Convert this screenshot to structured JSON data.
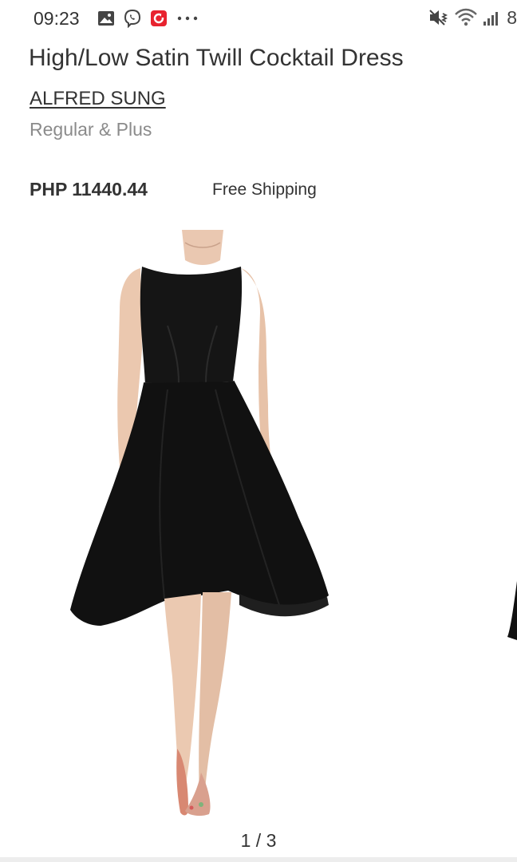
{
  "status_bar": {
    "time": "09:23",
    "battery_partial": "8",
    "left_icons": [
      "gallery-icon",
      "viber-icon",
      "app-notification-icon",
      "more-dots-icon"
    ],
    "right_icons": [
      "mute-vibrate-icon",
      "wifi-icon",
      "signal-icon"
    ]
  },
  "product": {
    "title": "High/Low Satin Twill Cocktail Dress",
    "brand": "ALFRED SUNG",
    "sizes": "Regular & Plus",
    "price": "PHP 11440.44",
    "shipping": "Free Shipping"
  },
  "gallery": {
    "pager": "1 / 3"
  },
  "colors": {
    "dress": "#111111",
    "skin": "#e9c6ae",
    "text": "#333333",
    "muted": "#8b8b8b"
  }
}
